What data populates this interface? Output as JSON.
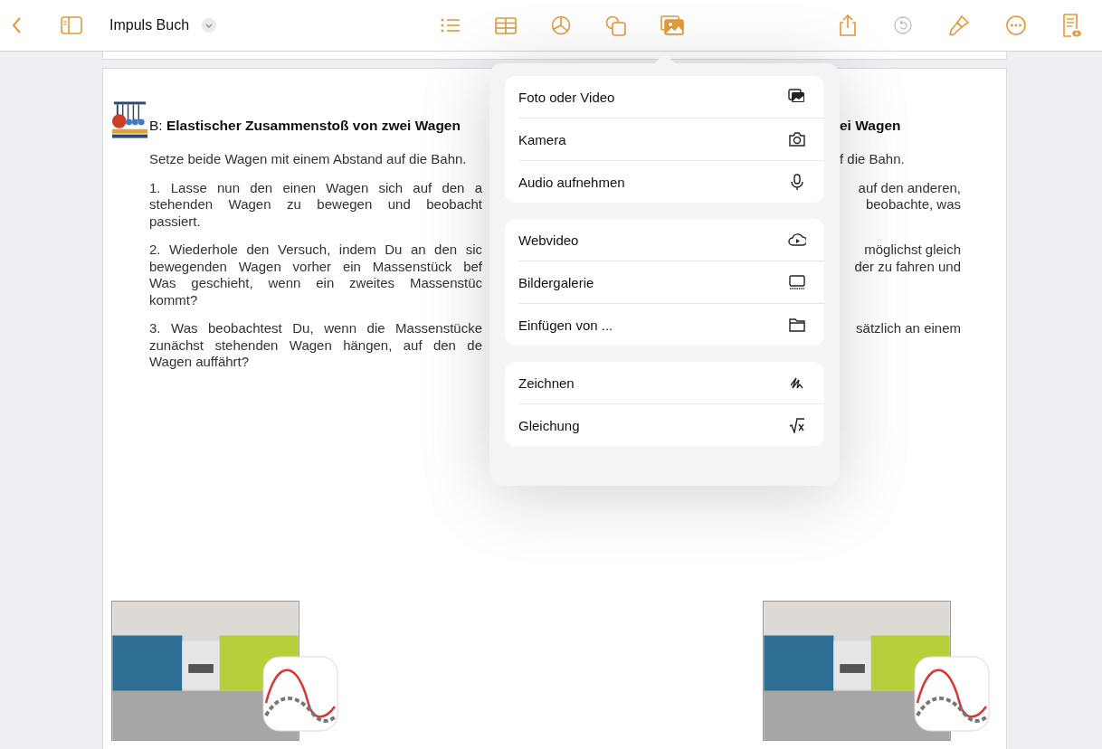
{
  "toolbar": {
    "left_tools": [
      {
        "kind": "back"
      },
      {
        "kind": "sidebar"
      }
    ],
    "title": "Impuls Buch",
    "center_tools": [
      {
        "kind": "list",
        "selected": false
      },
      {
        "kind": "table",
        "selected": false
      },
      {
        "kind": "chart",
        "selected": false
      },
      {
        "kind": "shape",
        "selected": false
      },
      {
        "kind": "media",
        "selected": true
      }
    ],
    "right_tools": [
      {
        "kind": "share",
        "disabled": false
      },
      {
        "kind": "undo",
        "disabled": true
      },
      {
        "kind": "brush",
        "disabled": false
      },
      {
        "kind": "more",
        "disabled": false
      },
      {
        "kind": "doc",
        "disabled": false
      }
    ]
  },
  "document": {
    "rows": [
      {
        "kind": "heading",
        "left": [
          "B: **Elastischer Zusammenstoß von zwei Wagen**"
        ],
        "right": [
          "ei Wagen"
        ]
      },
      {
        "kind": "text",
        "left": [
          "Setze beide Wagen mit einem Abstand auf die Bahn."
        ],
        "right": [
          "f die Bahn."
        ]
      },
      {
        "kind": "text",
        "left": [
          "1.   Lasse nun den einen Wagen sich auf den a",
          "stehenden Wagen zu bewegen und beobacht",
          "passiert."
        ],
        "right": [
          "auf den anderen,",
          "beobachte, was"
        ]
      },
      {
        "kind": "text",
        "left": [
          "2.   Wiederhole den Versuch, indem Du an den sic",
          "bewegenden Wagen vorher ein Massenstück bef",
          "Was geschieht, wenn ein zweites Massenstüc",
          "kommt?"
        ],
        "right": [
          "möglichst gleich",
          "der zu fahren und"
        ]
      },
      {
        "kind": "text",
        "left": [
          "3.   Was beobachtest Du, wenn die Massenstücke",
          "zunächst stehenden Wagen hängen, auf den de",
          "Wagen auffährt?"
        ],
        "right": [
          "sätzlich an einem"
        ]
      }
    ]
  },
  "insert_menu": {
    "groups": [
      [
        {
          "label": "Foto oder Video",
          "kind": "photos"
        },
        {
          "label": "Kamera",
          "kind": "camera"
        },
        {
          "label": "Audio aufnehmen",
          "kind": "mic"
        }
      ],
      [
        {
          "label": "Webvideo",
          "kind": "webvideo"
        },
        {
          "label": "Bildergalerie",
          "kind": "gallery"
        },
        {
          "label": "Einfügen von ...",
          "kind": "folder"
        }
      ],
      [
        {
          "label": "Zeichnen",
          "kind": "drawing"
        },
        {
          "label": "Gleichung",
          "kind": "equation"
        }
      ]
    ]
  }
}
